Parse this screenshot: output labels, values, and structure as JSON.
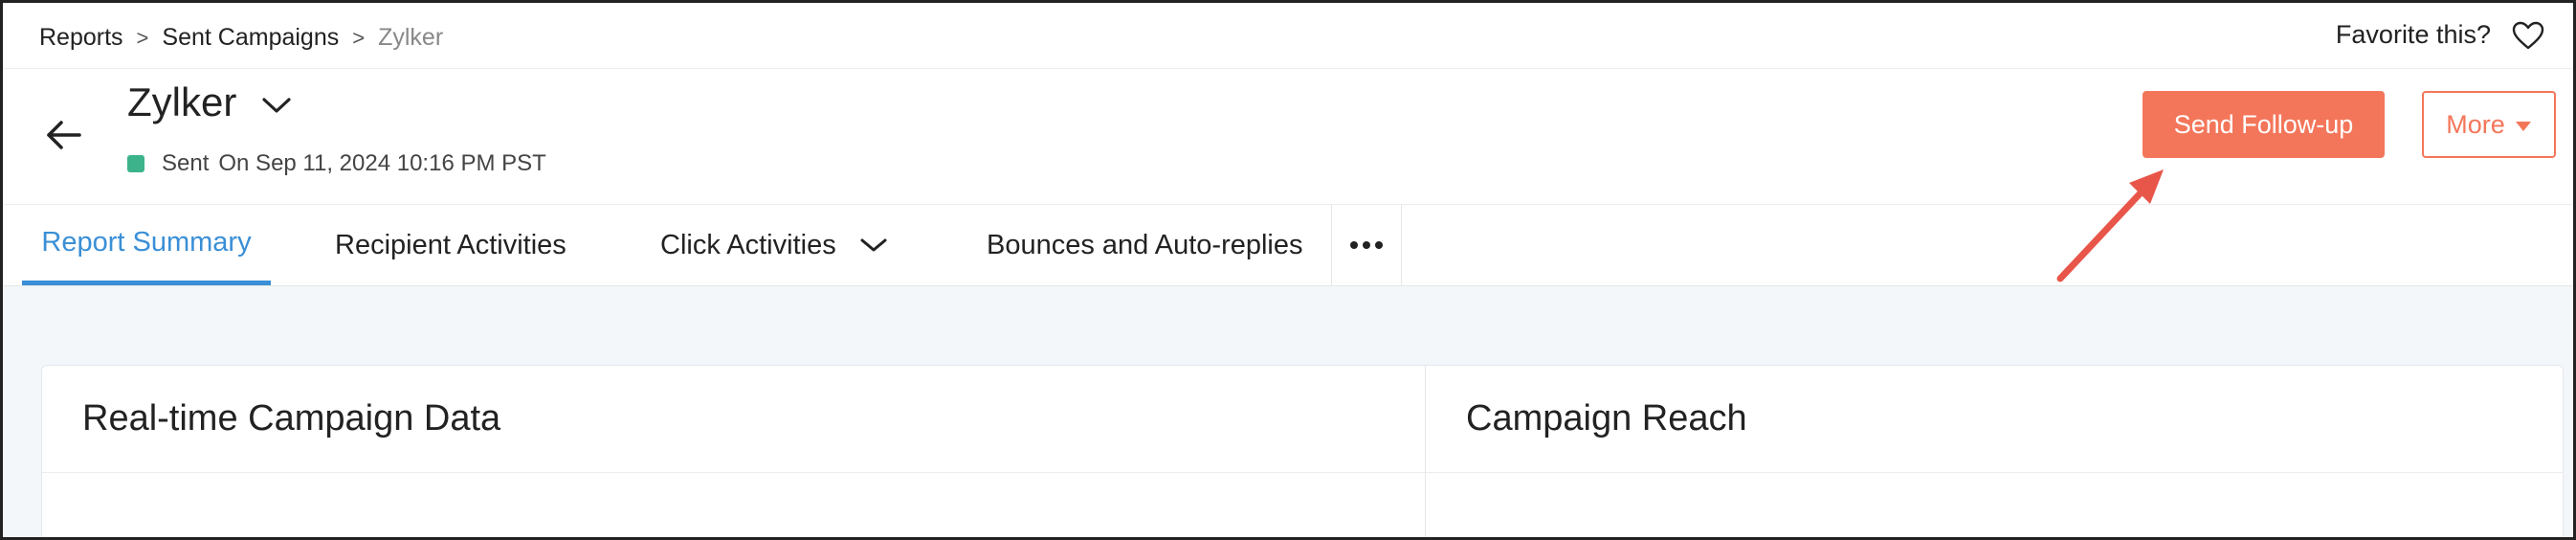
{
  "breadcrumb": {
    "items": [
      "Reports",
      "Sent Campaigns",
      "Zylker"
    ],
    "separator": ">"
  },
  "favorite": {
    "label": "Favorite this?"
  },
  "campaign": {
    "name": "Zylker",
    "status": "Sent",
    "sent_on": "On Sep 11, 2024 10:16 PM PST",
    "status_color": "#3cb38a"
  },
  "actions": {
    "primary_label": "Send Follow-up",
    "more_label": "More"
  },
  "tabs": [
    {
      "label": "Report Summary",
      "active": true
    },
    {
      "label": "Recipient Activities",
      "active": false
    },
    {
      "label": "Click Activities",
      "active": false
    },
    {
      "label": "Bounces and Auto-replies",
      "active": false
    }
  ],
  "tabs_overflow_icon": "ellipsis-icon",
  "panels": {
    "left_title": "Real-time Campaign Data",
    "right_title": "Campaign Reach"
  },
  "colors": {
    "accent": "#f4765a",
    "tab_active": "#3a8fd6",
    "annotation": "#e8564a"
  },
  "icons": {
    "back": "back-arrow-icon",
    "favorite": "heart-icon",
    "title_dropdown": "chevron-down-icon",
    "more_caret": "caret-down-icon"
  }
}
